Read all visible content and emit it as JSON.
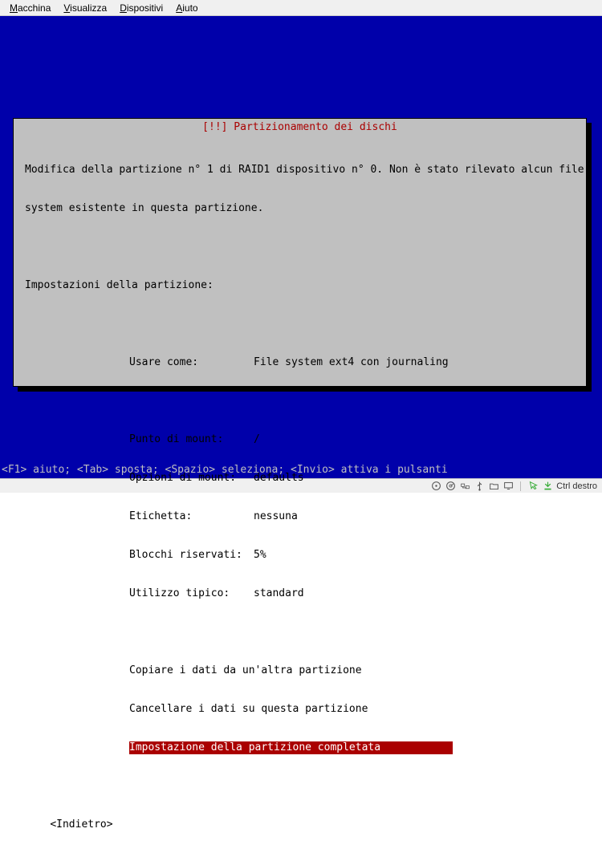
{
  "menubar": {
    "items": [
      {
        "key": "M",
        "rest": "acchina"
      },
      {
        "key": "V",
        "rest": "isualizza"
      },
      {
        "key": "D",
        "rest": "ispositivi"
      },
      {
        "key": "A",
        "rest": "iuto"
      }
    ]
  },
  "dialog": {
    "title": "[!!] Partizionamento dei dischi",
    "intro_line1": "Modifica della partizione n° 1 di RAID1 dispositivo n° 0. Non è stato rilevato alcun file",
    "intro_line2": "system esistente in questa partizione.",
    "settings_heading": "Impostazioni della partizione:",
    "settings": [
      {
        "label": "Usare come:",
        "value": "File system ext4 con journaling"
      },
      {
        "label": "",
        "value": ""
      },
      {
        "label": "Punto di mount:",
        "value": "/"
      },
      {
        "label": "Opzioni di mount:",
        "value": "defaults"
      },
      {
        "label": "Etichetta:",
        "value": "nessuna"
      },
      {
        "label": "Blocchi riservati:",
        "value": "5%"
      },
      {
        "label": "Utilizzo tipico:",
        "value": "standard"
      }
    ],
    "actions": [
      {
        "label": "Copiare i dati da un'altra partizione",
        "selected": false
      },
      {
        "label": "Cancellare i dati su questa partizione",
        "selected": false
      },
      {
        "label": "Impostazione della partizione completata",
        "selected": true
      }
    ],
    "back": "<Indietro>"
  },
  "footer_help": "<F1> aiuto; <Tab> sposta; <Spazio> seleziona; <Invio> attiva i pulsanti",
  "statusbar": {
    "host_key": "Ctrl destro"
  }
}
